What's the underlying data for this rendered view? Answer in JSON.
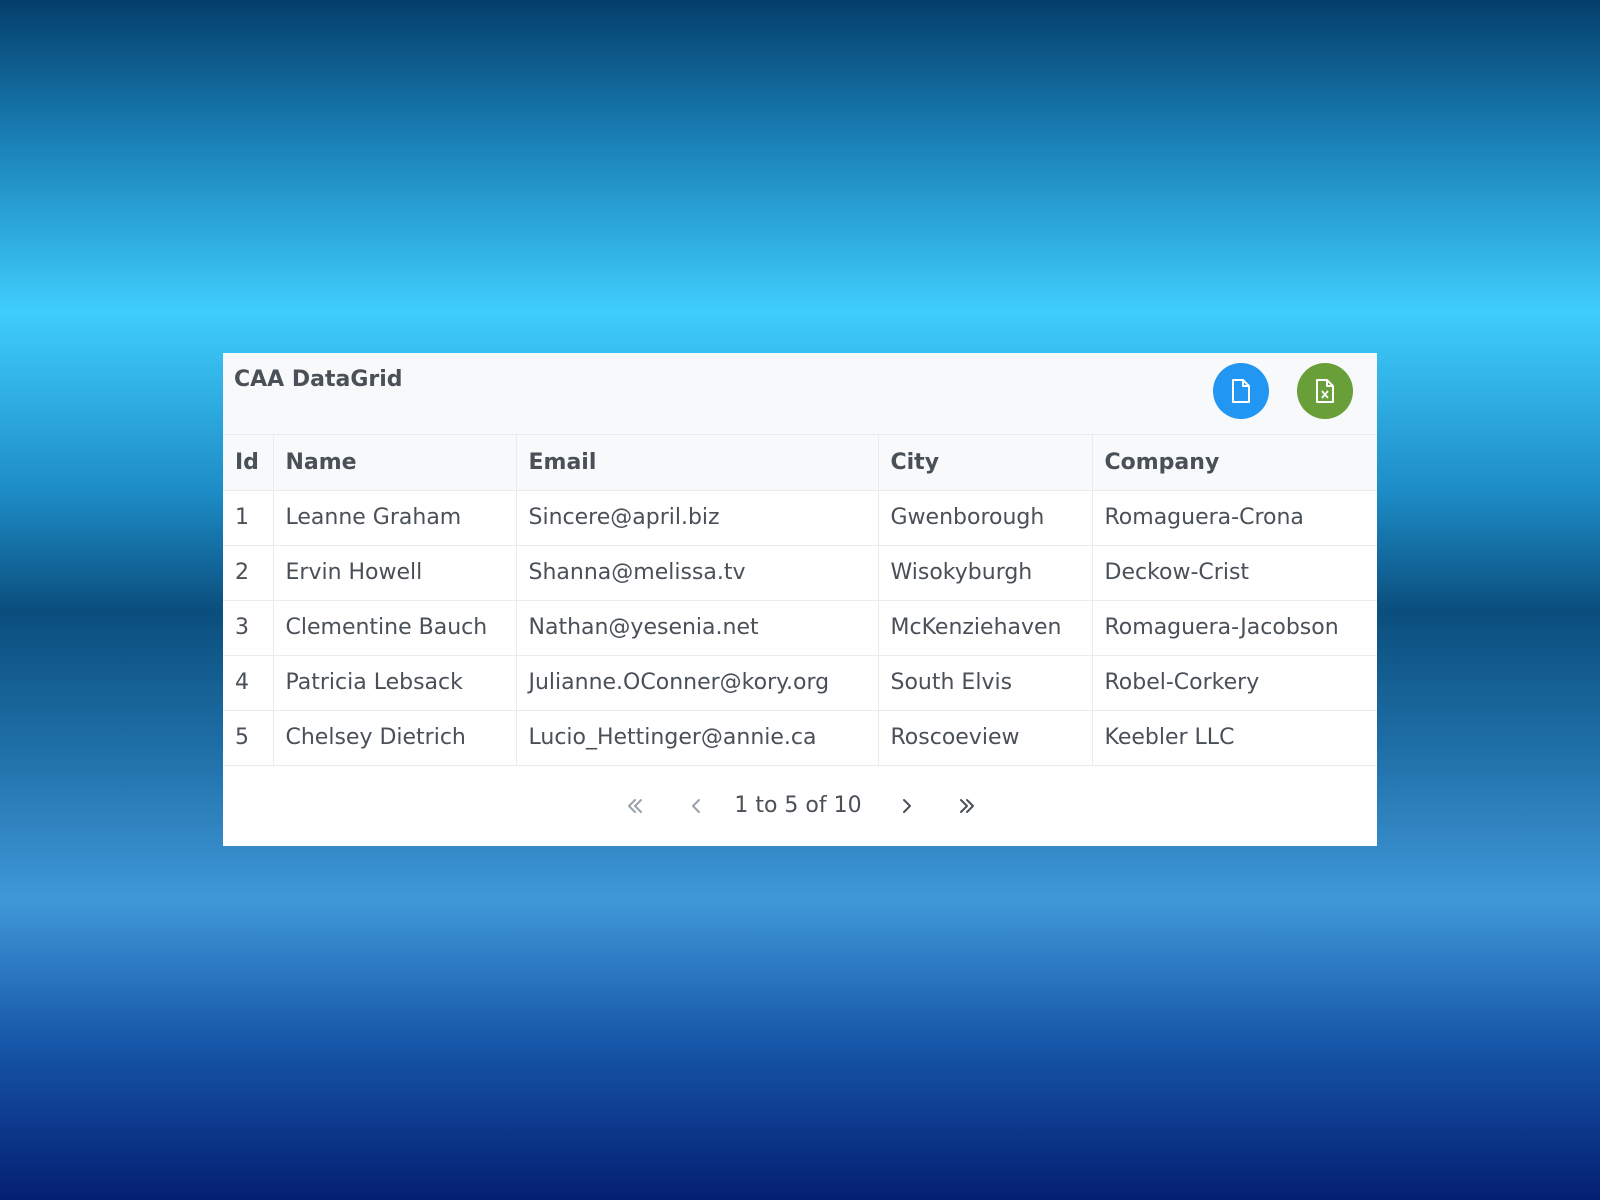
{
  "grid": {
    "title": "CAA DataGrid",
    "columns": [
      "Id",
      "Name",
      "Email",
      "City",
      "Company"
    ],
    "rows": [
      [
        "1",
        "Leanne Graham",
        "Sincere@april.biz",
        "Gwenborough",
        "Romaguera-Crona"
      ],
      [
        "2",
        "Ervin Howell",
        "Shanna@melissa.tv",
        "Wisokyburgh",
        "Deckow-Crist"
      ],
      [
        "3",
        "Clementine Bauch",
        "Nathan@yesenia.net",
        "McKenziehaven",
        "Romaguera-Jacobson"
      ],
      [
        "4",
        "Patricia Lebsack",
        "Julianne.OConner@kory.org",
        "South Elvis",
        "Robel-Corkery"
      ],
      [
        "5",
        "Chelsey Dietrich",
        "Lucio_Hettinger@annie.ca",
        "Roscoeview",
        "Keebler LLC"
      ]
    ]
  },
  "toolbar": {
    "export_csv_icon": "file-icon",
    "export_excel_icon": "file-excel-icon"
  },
  "paginator": {
    "report": "1 to 5 of 10",
    "first_icon": "double-chevron-left-icon",
    "prev_icon": "chevron-left-icon",
    "next_icon": "chevron-right-icon",
    "last_icon": "double-chevron-right-icon"
  },
  "colors": {
    "csv_button": "#2196f3",
    "excel_button": "#689f38",
    "text": "#495057"
  }
}
